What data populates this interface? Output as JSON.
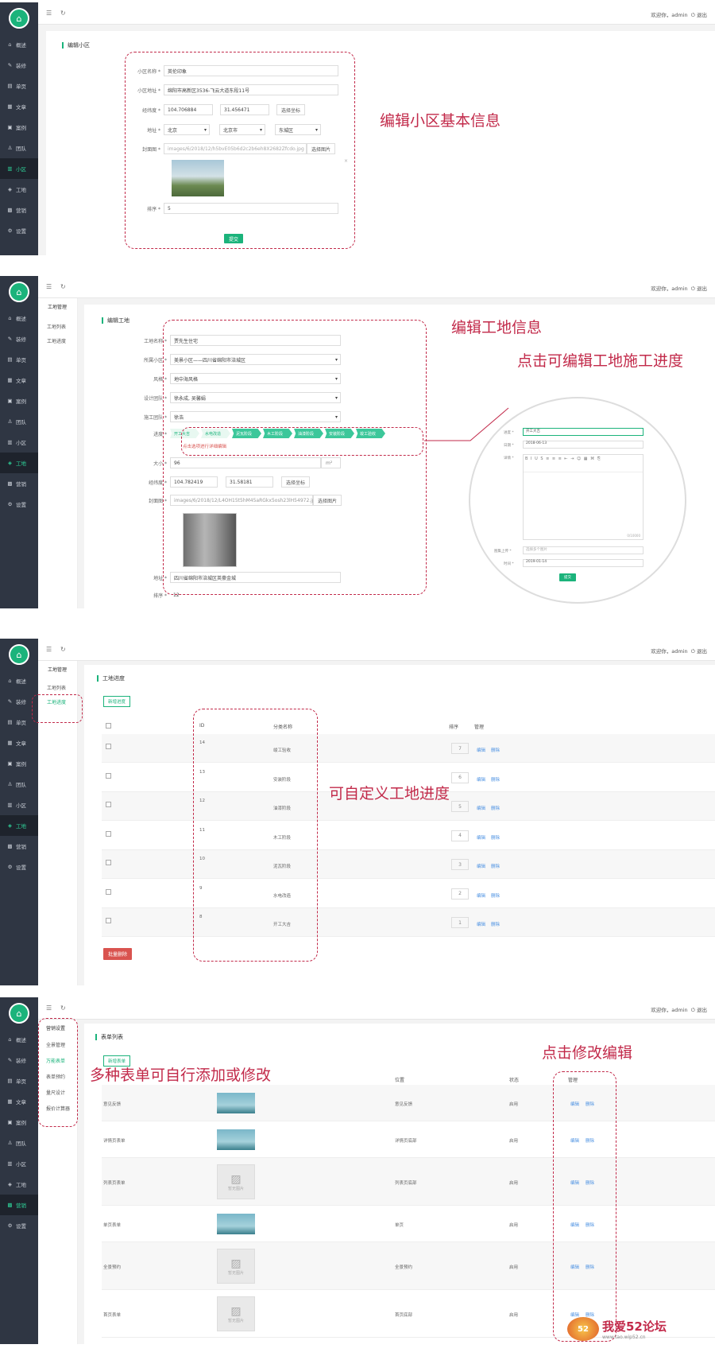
{
  "nav": {
    "items": [
      {
        "icon": "home-icon",
        "glyph": "⌂",
        "label": "概述"
      },
      {
        "icon": "wrench-icon",
        "glyph": "✎",
        "label": "装修"
      },
      {
        "icon": "page-icon",
        "glyph": "▤",
        "label": "单页"
      },
      {
        "icon": "article-icon",
        "glyph": "▦",
        "label": "文章"
      },
      {
        "icon": "case-icon",
        "glyph": "▣",
        "label": "案例"
      },
      {
        "icon": "team-icon",
        "glyph": "♙",
        "label": "团队"
      },
      {
        "icon": "community-icon",
        "glyph": "▥",
        "label": "小区"
      },
      {
        "icon": "site-icon",
        "glyph": "◈",
        "label": "工地"
      },
      {
        "icon": "marketing-icon",
        "glyph": "▩",
        "label": "营销"
      },
      {
        "icon": "settings-icon",
        "glyph": "⚙",
        "label": "设置"
      }
    ]
  },
  "topbar": {
    "menu_glyph": "☰",
    "refresh_glyph": "↻",
    "welcome": "欢迎你，admin",
    "logout": "⏻ 退出"
  },
  "p1": {
    "section_title": "编辑小区",
    "name_label": "小区名称 *",
    "name_value": "英伦印象",
    "addr_label": "小区地址 *",
    "addr_value": "绵阳市高新区3536-飞云大道东段11号",
    "geo_label": "经纬度 *",
    "lng": "104.706884",
    "lat": "31.456471",
    "pick_coords": "选择坐标",
    "region_label": "地址 *",
    "province": "北京",
    "city": "北京市",
    "district": "东城区",
    "cover_label": "封面图 *",
    "cover_path": "images/6/2018/12/h5bvE05b6d2c2b6eh8X2682Zfcdo.jpg",
    "choose_image": "选择图片",
    "remove": "×",
    "sort_label": "排序 *",
    "sort_value": "5",
    "submit": "提交",
    "annotation": "编辑小区基本信息"
  },
  "p2": {
    "subnav_title": "工地管理",
    "subnav": [
      "工地列表",
      "工地进度"
    ],
    "section_title": "编辑工地",
    "name_label": "工地名称 *",
    "name_value": "贾先生住宅",
    "community_label": "所属小区 *",
    "community_value": "美景小区——四川省绵阳市涪城区",
    "style_label": "风格 *",
    "style_value": "地中海风格",
    "design_label": "设计团队 *",
    "design_value": "徐永成, 吴馨娟",
    "build_label": "施工团队 *",
    "build_value": "徐浩",
    "progress_label": "进度 *",
    "steps": [
      "开工大吉",
      "水电改造",
      "泥瓦阶段",
      "木工阶段",
      "油漆阶段",
      "安装阶段",
      "竣工验收"
    ],
    "progress_hint": "点击选项进行详细编辑",
    "size_label": "大小 *",
    "size_value": "96",
    "size_unit": "m²",
    "geo_label": "经纬度 *",
    "lng": "104.782419",
    "lat": "31.58181",
    "pick_coords": "选择坐标",
    "cover_label": "封面图 *",
    "cover_path": "images/6/2018/12/L4OH15t5hM45aRGkx5osh23lH54972.jpg",
    "choose_image": "选择图片",
    "addr_label": "地址 *",
    "addr_value": "四川省绵阳市涪城区英豪金城",
    "sort_label": "排序 *",
    "sort_value": "12",
    "annotation1": "编辑工地信息",
    "annotation2": "点击可编辑工地施工进度",
    "zoom": {
      "title_label": "进度 *",
      "title_value": "开工大吉",
      "date_label": "日期 *",
      "date_value": "2018-06-13",
      "content_label": "详情 *",
      "upload_label": "图集上传 *",
      "upload_value": "选择多个图片",
      "time_label": "时间 *",
      "time_value": "2019-01-14",
      "submit": "提交",
      "editor_count": "0/10000"
    }
  },
  "p3": {
    "subnav_title": "工地管理",
    "subnav": [
      "工地列表",
      "工地进度"
    ],
    "section_title": "工地进度",
    "add_button": "新增进度",
    "headers": {
      "id": "ID",
      "name": "分类名称",
      "sort": "排序",
      "manage": "管理"
    },
    "rows": [
      {
        "id": "14",
        "name": "竣工验收",
        "sort": "7"
      },
      {
        "id": "13",
        "name": "安装阶段",
        "sort": "6"
      },
      {
        "id": "12",
        "name": "油漆阶段",
        "sort": "5"
      },
      {
        "id": "11",
        "name": "木工阶段",
        "sort": "4"
      },
      {
        "id": "10",
        "name": "泥瓦阶段",
        "sort": "3"
      },
      {
        "id": "9",
        "name": "水电改造",
        "sort": "2"
      },
      {
        "id": "8",
        "name": "开工大吉",
        "sort": "1"
      }
    ],
    "edit": "编辑",
    "delete": "删除",
    "batch_delete": "批量删除",
    "annotation": "可自定义工地进度"
  },
  "p4": {
    "subnav_title": "营销设置",
    "subnav": [
      "全景管理",
      "万能表单",
      "表单预约",
      "量尺设计",
      "报价计算器"
    ],
    "section_title": "表单列表",
    "add_button": "新增表单",
    "headers": {
      "position": "位置",
      "status": "状态",
      "manage": "管理"
    },
    "rows": [
      {
        "name": "意见反馈",
        "img": true,
        "position": "意见反馈",
        "status": "启用"
      },
      {
        "name": "详情页表单",
        "img": true,
        "position": "详情页底部",
        "status": "启用"
      },
      {
        "name": "列表页表单",
        "img": false,
        "position": "列表页底部",
        "status": "启用"
      },
      {
        "name": "单页表单",
        "img": true,
        "position": "单页",
        "status": "启用"
      },
      {
        "name": "全景预约",
        "img": false,
        "position": "全景预约",
        "status": "启用"
      },
      {
        "name": "首页表单",
        "img": false,
        "position": "首页底部",
        "status": "启用"
      }
    ],
    "no_image": "暂无图片",
    "edit": "编辑",
    "delete": "删除",
    "annotation1": "多种表单可自行添加或修改",
    "annotation2": "点击修改编辑"
  },
  "watermark": {
    "text": "我爱52论坛",
    "url": "www.tao.wip52.cn"
  }
}
